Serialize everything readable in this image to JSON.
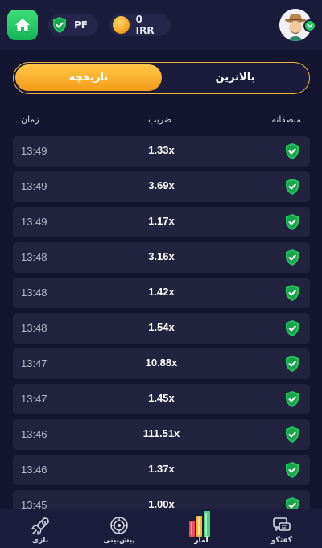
{
  "header": {
    "home_icon": "home-icon",
    "pf_label": "PF",
    "balance_label": "0 IRR",
    "colors": {
      "accent_green": "#24c45e",
      "accent_orange": "#f49b18"
    }
  },
  "tabs": {
    "history": "تاریخچه",
    "top": "بالاترین"
  },
  "columns": {
    "time": "زمان",
    "multiplier": "ضریب",
    "provably_fair": "منصفانه"
  },
  "rows": [
    {
      "time": "13:49",
      "multiplier": "1.33x"
    },
    {
      "time": "13:49",
      "multiplier": "3.69x"
    },
    {
      "time": "13:49",
      "multiplier": "1.17x"
    },
    {
      "time": "13:48",
      "multiplier": "3.16x"
    },
    {
      "time": "13:48",
      "multiplier": "1.42x"
    },
    {
      "time": "13:48",
      "multiplier": "1.54x"
    },
    {
      "time": "13:47",
      "multiplier": "10.88x"
    },
    {
      "time": "13:47",
      "multiplier": "1.45x"
    },
    {
      "time": "13:46",
      "multiplier": "111.51x"
    },
    {
      "time": "13:46",
      "multiplier": "1.37x"
    },
    {
      "time": "13:45",
      "multiplier": "1.00x"
    }
  ],
  "nav": {
    "game": "بازی",
    "prediction": "پیش‌بینی",
    "stats": "آمار",
    "chat": "گفتگو"
  }
}
